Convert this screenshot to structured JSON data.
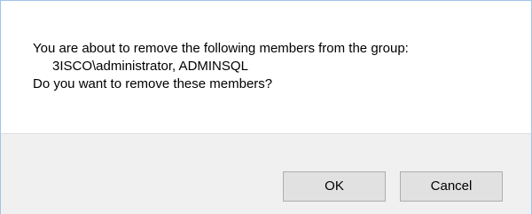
{
  "dialog": {
    "message_line1": "You are about to remove the following members from the group:",
    "message_line2": "3ISCO\\administrator, ADMINSQL",
    "message_line3": "Do you want to remove these members?",
    "ok_label": "OK",
    "cancel_label": "Cancel"
  },
  "colors": {
    "footer_background": "#f0f0f0",
    "button_background": "#e1e1e1",
    "button_border": "#adadad"
  }
}
